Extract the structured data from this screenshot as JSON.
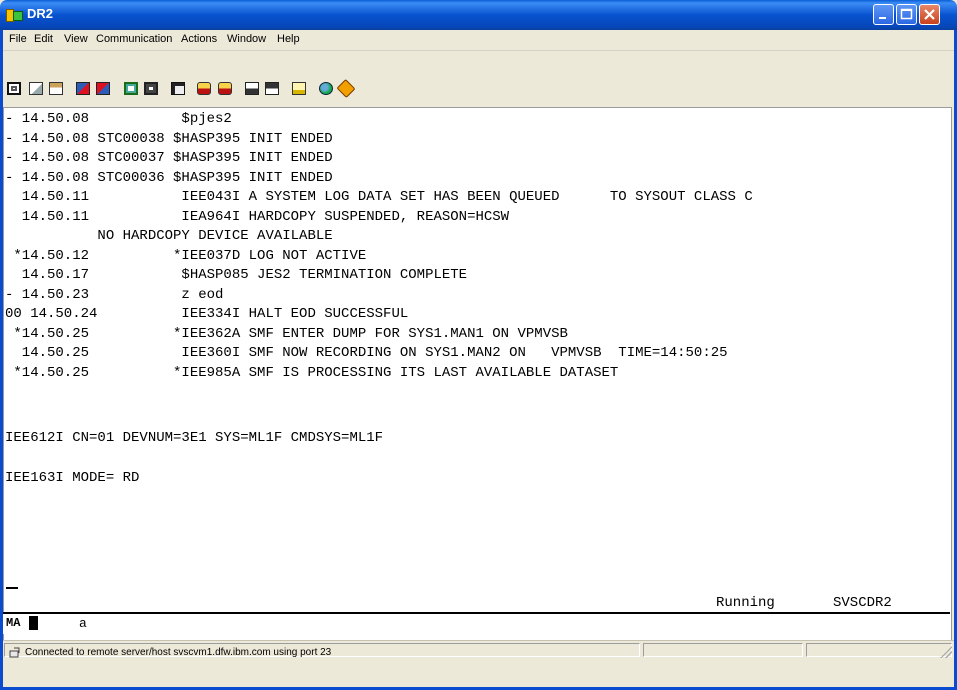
{
  "window": {
    "title": "DR2"
  },
  "menu": [
    {
      "label": "File"
    },
    {
      "label": "Edit"
    },
    {
      "label": "View"
    },
    {
      "label": "Communication"
    },
    {
      "label": "Actions"
    },
    {
      "label": "Window"
    },
    {
      "label": "Help"
    }
  ],
  "toolbar_icons": [
    "screen-icon",
    "copy-icon",
    "paste-icon",
    "send-file-icon",
    "receive-file-icon",
    "display-icon",
    "monitor-icon",
    "calculator-icon",
    "macro-play-icon",
    "macro-record-icon",
    "record-icon",
    "stop-record-icon",
    "notepad-icon",
    "globe-icon",
    "tag-icon"
  ],
  "terminal": {
    "lines": [
      "- 14.50.08           $pjes2",
      "- 14.50.08 STC00038 $HASP395 INIT ENDED",
      "- 14.50.08 STC00037 $HASP395 INIT ENDED",
      "- 14.50.08 STC00036 $HASP395 INIT ENDED",
      "  14.50.11           IEE043I A SYSTEM LOG DATA SET HAS BEEN QUEUED      TO SYSOUT CLASS C",
      "  14.50.11           IEA964I HARDCOPY SUSPENDED, REASON=HCSW",
      "           NO HARDCOPY DEVICE AVAILABLE",
      " *14.50.12          *IEE037D LOG NOT ACTIVE",
      "  14.50.17           $HASP085 JES2 TERMINATION COMPLETE",
      "- 14.50.23           z eod",
      "00 14.50.24          IEE334I HALT EOD SUCCESSFUL",
      " *14.50.25          *IEE362A SMF ENTER DUMP FOR SYS1.MAN1 ON VPMVSB",
      "  14.50.25           IEE360I SMF NOW RECORDING ON SYS1.MAN2 ON   VPMVSB  TIME=14:50:25",
      " *14.50.25          *IEE985A SMF IS PROCESSING ITS LAST AVAILABLE DATASET",
      "",
      "",
      "IEE612I CN=01 DEVNUM=3E1 SYS=ML1F CMDSYS=ML1F",
      "",
      "IEE163I MODE= RD"
    ],
    "status_running": "Running",
    "status_system": "SVSCDR2"
  },
  "oia": {
    "mode": "MA",
    "input": "a"
  },
  "statusbar": {
    "connection_text": "Connected to remote server/host svscvm1.dfw.ibm.com using port 23"
  }
}
